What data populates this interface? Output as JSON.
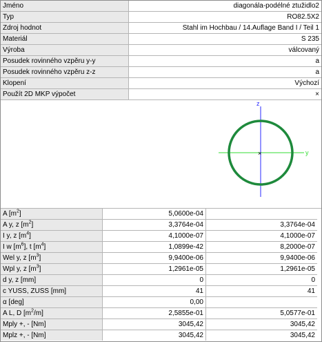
{
  "properties": [
    {
      "label": "Jméno",
      "value": "diagonála-podélné ztužidlo2"
    },
    {
      "label": "Typ",
      "value": "RO82.5X2"
    },
    {
      "label": "Zdroj hodnot",
      "value": "Stahl im Hochbau / 14.Auflage Band I / Teil 1"
    },
    {
      "label": "Materiál",
      "value": "S 235"
    },
    {
      "label": "Výroba",
      "value": "válcovaný"
    },
    {
      "label": "Posudek rovinného vzpěru y-y",
      "value": "a"
    },
    {
      "label": "Posudek rovinného vzpěru z-z",
      "value": "a"
    },
    {
      "label": "Klopení",
      "value": "Výchozí"
    },
    {
      "label": "Použít 2D MKP výpočet",
      "value": "×"
    }
  ],
  "drawing": {
    "axis_z": "z",
    "axis_y": "y",
    "ring_color": "#1e8a3c",
    "y_axis_color": "#33dd33",
    "z_axis_color": "#2a2aff"
  },
  "values": [
    {
      "label_html": "A [m<sup>2</sup>]",
      "v1": "5,0600e-04",
      "v2": ""
    },
    {
      "label_html": "A y, z [m<sup>2</sup>]",
      "v1": "3,3764e-04",
      "v2": "3,3764e-04"
    },
    {
      "label_html": "I y, z [m<sup>4</sup>]",
      "v1": "4,1000e-07",
      "v2": "4,1000e-07"
    },
    {
      "label_html": "I w [m<sup>6</sup>], t [m<sup>4</sup>]",
      "v1": "1,0899e-42",
      "v2": "8,2000e-07"
    },
    {
      "label_html": "Wel y, z [m<sup>3</sup>]",
      "v1": "9,9400e-06",
      "v2": "9,9400e-06"
    },
    {
      "label_html": "Wpl y, z [m<sup>3</sup>]",
      "v1": "1,2961e-05",
      "v2": "1,2961e-05"
    },
    {
      "label_html": "d y, z [mm]",
      "v1": "0",
      "v2": "0"
    },
    {
      "label_html": "c YUSS, ZUSS [mm]",
      "v1": "41",
      "v2": "41"
    },
    {
      "label_html": "α [deg]",
      "v1": "0,00",
      "v2": ""
    },
    {
      "label_html": "A L, D [m<sup>2</sup>/m]",
      "v1": "2,5855e-01",
      "v2": "5,0577e-01"
    },
    {
      "label_html": "Mply +, - [Nm]",
      "v1": "3045,42",
      "v2": "3045,42"
    },
    {
      "label_html": "Mplz +, - [Nm]",
      "v1": "3045,42",
      "v2": "3045,42"
    }
  ]
}
